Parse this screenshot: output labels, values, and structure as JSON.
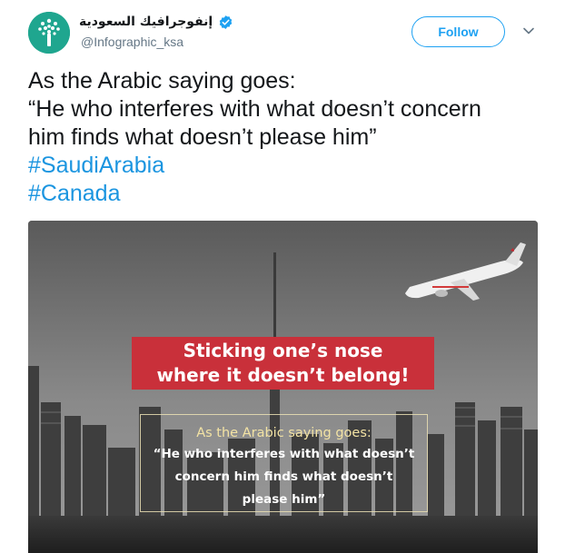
{
  "tweet": {
    "author": {
      "display_name": "إنفوجرافيك السعودية",
      "handle": "@Infographic_ksa",
      "verified": true,
      "avatar_icon": "tree-logo-icon",
      "avatar_color": "#1fa68f"
    },
    "follow_label": "Follow",
    "more_icon": "chevron-down-icon",
    "text_lines": [
      "As the Arabic saying goes:",
      "“He who interferes with what doesn’t concern",
      "him finds what doesn’t please him”"
    ],
    "hashtags": [
      "#SaudiArabia",
      "#Canada"
    ],
    "accent_color": "#1da1f2"
  },
  "media": {
    "banner_lines": [
      "Sticking one’s nose",
      "where it doesn’t belong!"
    ],
    "quote_heading": "As the Arabic saying goes:",
    "quote_lines": [
      "“He who interferes with what doesn’t",
      "concern him finds what doesn’t",
      "please him”"
    ],
    "banner_color": "#c9303a"
  }
}
